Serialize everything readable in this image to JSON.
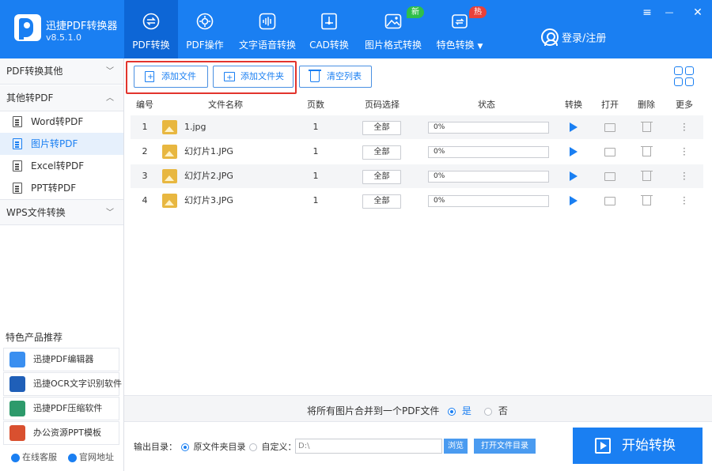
{
  "app": {
    "name": "迅捷PDF转换器",
    "version": "v8.5.1.0"
  },
  "nav": [
    {
      "label": "PDF转换",
      "icon": "swap-arrows-icon"
    },
    {
      "label": "PDF操作",
      "icon": "gear-icon"
    },
    {
      "label": "文字语音转换",
      "icon": "sound-wave-icon"
    },
    {
      "label": "CAD转换",
      "icon": "cad-icon"
    },
    {
      "label": "图片格式转换",
      "icon": "image-icon",
      "badge": "新"
    },
    {
      "label": "特色转换",
      "icon": "feature-convert-icon",
      "badge": "热"
    }
  ],
  "login": "登录/注册",
  "window": {
    "menu": "≡",
    "minimize": "—",
    "close": "✕"
  },
  "sidebar": {
    "groups": [
      "PDF转换其他",
      "其他转PDF",
      "WPS文件转换"
    ],
    "items": [
      "Word转PDF",
      "图片转PDF",
      "Excel转PDF",
      "PPT转PDF"
    ],
    "featured_title": "特色产品推荐",
    "featured": [
      "迅捷PDF编辑器",
      "迅捷OCR文字识别软件",
      "迅捷PDF压缩软件",
      "办公资源PPT模板"
    ],
    "footer": [
      "在线客服",
      "官网地址"
    ]
  },
  "toolbar": {
    "add_file": "添加文件",
    "add_folder": "添加文件夹",
    "clear_list": "清空列表"
  },
  "table": {
    "headers": [
      "编号",
      "文件名称",
      "页数",
      "页码选择",
      "状态",
      "转换",
      "打开",
      "删除",
      "更多"
    ],
    "rows": [
      {
        "num": "1",
        "name": "1.jpg",
        "pages": "1",
        "range": "全部",
        "status": "0%"
      },
      {
        "num": "2",
        "name": "幻灯片1.JPG",
        "pages": "1",
        "range": "全部",
        "status": "0%"
      },
      {
        "num": "3",
        "name": "幻灯片2.JPG",
        "pages": "1",
        "range": "全部",
        "status": "0%"
      },
      {
        "num": "4",
        "name": "幻灯片3.JPG",
        "pages": "1",
        "range": "全部",
        "status": "0%"
      }
    ]
  },
  "merge": {
    "label": "将所有图片合并到一个PDF文件",
    "yes": "是",
    "no": "否"
  },
  "output": {
    "label": "输出目录：",
    "original": "原文件夹目录",
    "custom": "自定义：",
    "path": "D:\\",
    "browse": "浏览",
    "open_dir": "打开文件目录"
  },
  "start_button": "开始转换",
  "colors": {
    "primary": "#1a7ff2",
    "badge_new": "#2fbf4a",
    "badge_hot": "#e8413a",
    "highlight": "#e2342d"
  }
}
